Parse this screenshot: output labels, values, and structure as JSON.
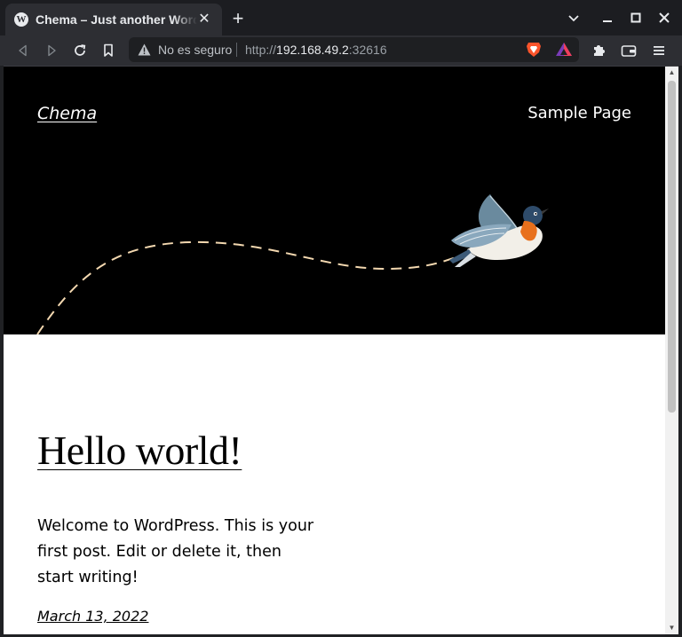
{
  "browser": {
    "tab_title": "Chema – Just another WordPress site",
    "favicon": "wordpress-icon",
    "new_tab_symbol": "+",
    "tab_close_symbol": "✕",
    "security_label": "No es seguro",
    "url_scheme": "http://",
    "url_host": "192.168.49.2",
    "url_port": ":32616",
    "colors": {
      "chrome_bg": "#1c1d21",
      "toolbar_bg": "#2d2e33",
      "omnibox_bg": "#1e1f22",
      "brave_orange": "#fb542b"
    },
    "icons": [
      "back-icon",
      "forward-icon",
      "reload-icon",
      "bookmark-icon",
      "warning-icon",
      "brave-shields-icon",
      "brave-rewards-icon",
      "extensions-icon",
      "wallet-icon",
      "menu-icon",
      "chevron-down-icon",
      "minimize-icon",
      "maximize-icon",
      "close-icon"
    ]
  },
  "site": {
    "title": "Chema",
    "nav": [
      "Sample Page"
    ],
    "hero_bg": "#000000",
    "path_color": "#f3d8b0"
  },
  "post": {
    "title": "Hello world!",
    "excerpt": "Welcome to WordPress. This is your first post. Edit or delete it, then start writing!",
    "date": "March 13, 2022"
  }
}
